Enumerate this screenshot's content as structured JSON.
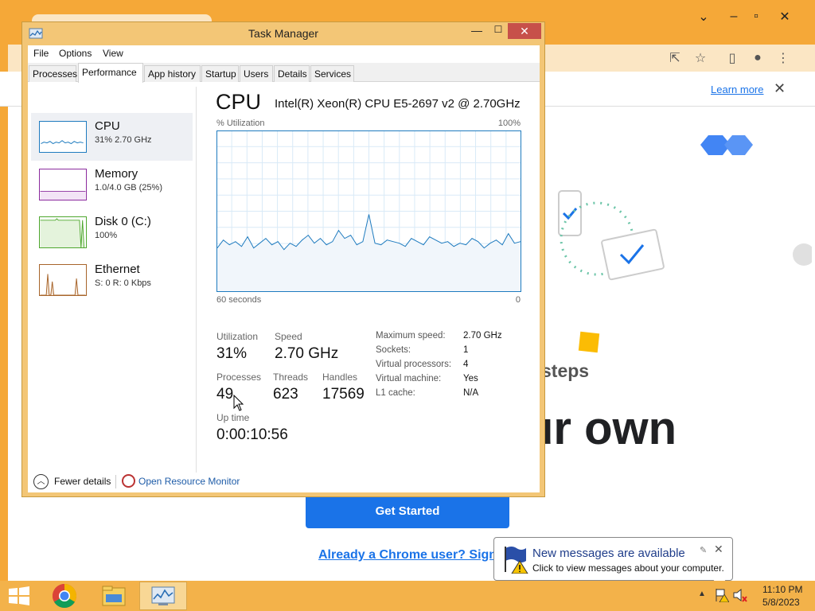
{
  "chrome": {
    "learn_more": "Learn more",
    "info_close": "✕",
    "steps_text": "steps",
    "heading_text": "ur own",
    "get_started": "Get Started",
    "signin_link": "Already a Chrome user? Sign in"
  },
  "task_manager": {
    "title": "Task Manager",
    "menu": [
      "File",
      "Options",
      "View"
    ],
    "tabs": [
      "Processes",
      "Performance",
      "App history",
      "Startup",
      "Users",
      "Details",
      "Services"
    ],
    "active_tab": "Performance",
    "resources": [
      {
        "name": "CPU",
        "sub": "31%  2.70 GHz",
        "color": "#1e7bbf"
      },
      {
        "name": "Memory",
        "sub": "1.0/4.0 GB (25%)",
        "color": "#8b2b9e"
      },
      {
        "name": "Disk 0 (C:)",
        "sub": "100%",
        "color": "#4ea72e"
      },
      {
        "name": "Ethernet",
        "sub": "S: 0  R: 0 Kbps",
        "color": "#a7642a"
      }
    ],
    "cpu": {
      "title": "CPU",
      "model": "Intel(R) Xeon(R) CPU E5-2697 v2 @ 2.70GHz",
      "util_label": "% Utilization",
      "util_max": "100%",
      "time_left": "60 seconds",
      "time_right": "0",
      "utilization_label": "Utilization",
      "utilization": "31%",
      "speed_label": "Speed",
      "speed": "2.70 GHz",
      "processes_label": "Processes",
      "processes": "49",
      "threads_label": "Threads",
      "threads": "623",
      "handles_label": "Handles",
      "handles": "17569",
      "uptime_label": "Up time",
      "uptime": "0:00:10:56",
      "specs": [
        {
          "key": "Maximum speed:",
          "val": "2.70 GHz"
        },
        {
          "key": "Sockets:",
          "val": "1"
        },
        {
          "key": "Virtual processors:",
          "val": "4"
        },
        {
          "key": "Virtual machine:",
          "val": "Yes"
        },
        {
          "key": "L1 cache:",
          "val": "N/A"
        }
      ],
      "history": [
        27,
        32,
        29,
        31,
        28,
        34,
        27,
        30,
        33,
        29,
        31,
        26,
        30,
        28,
        32,
        35,
        30,
        33,
        29,
        31,
        38,
        33,
        35,
        29,
        31,
        48,
        30,
        29,
        32,
        31,
        30,
        28,
        33,
        31,
        29,
        34,
        32,
        30,
        31,
        28,
        30,
        29,
        33,
        31,
        27,
        30,
        32,
        29,
        36,
        30,
        31
      ]
    },
    "fewer_details": "Fewer details",
    "open_resource_monitor": "Open Resource Monitor"
  },
  "notification": {
    "title": "New messages are available",
    "text": "Click to view messages about your computer."
  },
  "taskbar": {
    "time": "11:10 PM",
    "date": "5/8/2023"
  }
}
